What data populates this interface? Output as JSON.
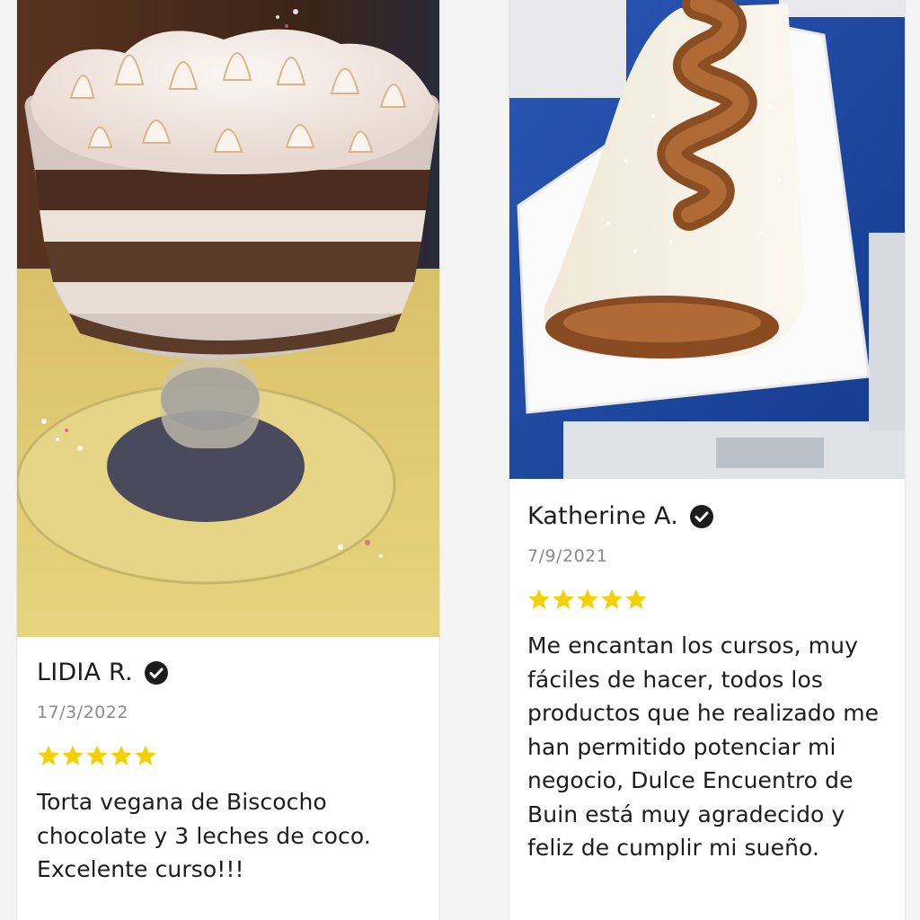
{
  "colors": {
    "star": "#f5d000",
    "text": "#1c1c1c",
    "muted": "#8a8a8a",
    "card": "#ffffff"
  },
  "reviews": [
    {
      "author": "LIDIA R.",
      "verified_icon": "check-circle-icon",
      "date": "17/3/2022",
      "rating": 5,
      "text": "Torta vegana de Biscocho chocolate y 3 leches de coco. Excelente curso!!!"
    },
    {
      "author": "Katherine A.",
      "verified_icon": "check-circle-icon",
      "date": "7/9/2021",
      "rating": 5,
      "text": "Me encantan los cursos, muy fáciles de hacer, todos los productos que he realizado me han permitido potenciar mi negocio, Dulce Encuentro de Buin está muy agradecido y feliz de cumplir mi sueño."
    }
  ]
}
